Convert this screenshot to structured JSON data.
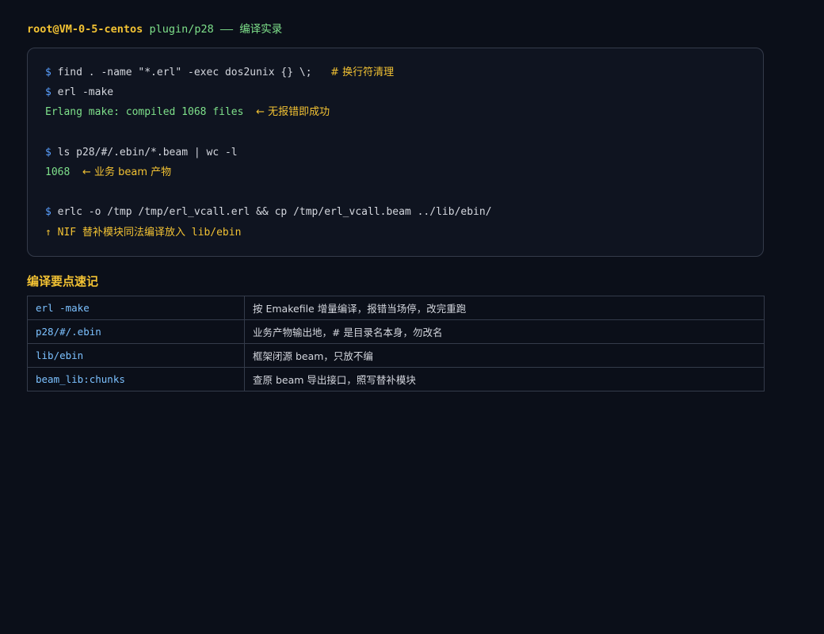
{
  "header": {
    "user_host": "root@VM-0-5-centos",
    "path": "plugin/p28",
    "separator": " —— ",
    "title": "编译实录"
  },
  "terminal": {
    "prompt_symbol": "$",
    "lines": [
      {
        "command": "find . -name \"*.erl\" -exec dos2unix {} \\;",
        "comment": "# 换行符清理"
      },
      {
        "command": "erl -make"
      },
      {
        "output": "Erlang make: compiled 1068 files",
        "note": "← 无报错即成功"
      },
      {
        "command": "ls p28/#/.ebin/*.beam | wc -l"
      },
      {
        "output": "1068",
        "note": "← 业务 beam 产物"
      },
      {
        "command": "erlc -o /tmp /tmp/erl_vcall.erl && cp /tmp/erl_vcall.beam ../lib/ebin/"
      },
      {
        "note": "↑ NIF 替补模块同法编译放入 lib/ebin"
      }
    ]
  },
  "section": {
    "title": "编译要点速记"
  },
  "table": {
    "rows": [
      {
        "key": "erl -make",
        "value": "按 Emakefile 增量编译，报错当场停，改完重跑"
      },
      {
        "key": "p28/#/.ebin",
        "value": "业务产物输出地，# 是目录名本身，勿改名"
      },
      {
        "key": "lib/ebin",
        "value": "框架闭源 beam，只放不编"
      },
      {
        "key": "beam_lib:chunks",
        "value": "查原 beam 导出接口，照写替补模块"
      }
    ]
  },
  "colors": {
    "background": "#0b0f19",
    "accent_yellow": "#f2c233",
    "output_green": "#7ee08a",
    "prompt_blue": "#5aa0ff",
    "key_blue": "#7cc1ff"
  }
}
